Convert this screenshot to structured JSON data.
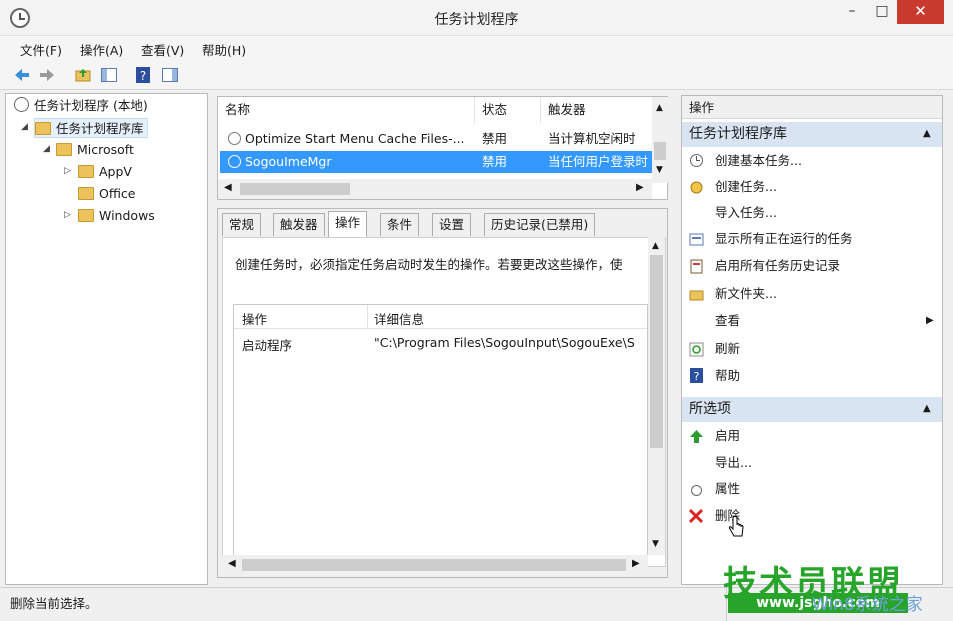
{
  "window": {
    "title": "任务计划程序",
    "min": "–",
    "max": "□",
    "close": "✕"
  },
  "menu": [
    "文件(F)",
    "操作(A)",
    "查看(V)",
    "帮助(H)"
  ],
  "tree": {
    "root": "任务计划程序 (本地)",
    "library": "任务计划程序库",
    "microsoft": "Microsoft",
    "children": [
      "AppV",
      "Office",
      "Windows"
    ]
  },
  "task_list": {
    "headers": [
      "名称",
      "状态",
      "触发器"
    ],
    "rows": [
      {
        "name": "Optimize Start Menu Cache Files-...",
        "status": "禁用",
        "trigger": "当计算机空闲时"
      },
      {
        "name": "SogouImeMgr",
        "status": "禁用",
        "trigger": "当任何用户登录时"
      }
    ]
  },
  "tabs": [
    "常规",
    "触发器",
    "操作",
    "条件",
    "设置",
    "历史记录(已禁用)"
  ],
  "active_tab": "操作",
  "description": "创建任务时，必须指定任务启动时发生的操作。若要更改这些操作，使",
  "action_table": {
    "headers": [
      "操作",
      "详细信息"
    ],
    "row": {
      "action": "启动程序",
      "detail": "\"C:\\Program Files\\SogouInput\\SogouExe\\S"
    }
  },
  "actions_pane": {
    "title": "操作",
    "section1": "任务计划程序库",
    "items1": [
      "创建基本任务...",
      "创建任务...",
      "导入任务...",
      "显示所有正在运行的任务",
      "启用所有任务历史记录",
      "新文件夹...",
      "查看",
      "刷新",
      "帮助"
    ],
    "section2": "所选项",
    "items2": [
      "启用",
      "导出...",
      "属性",
      "删除"
    ]
  },
  "status": "删除当前选择。",
  "watermark": {
    "brand": "技术员联盟",
    "url": "www.jsgho.com",
    "sub": "Win8系统之家"
  }
}
